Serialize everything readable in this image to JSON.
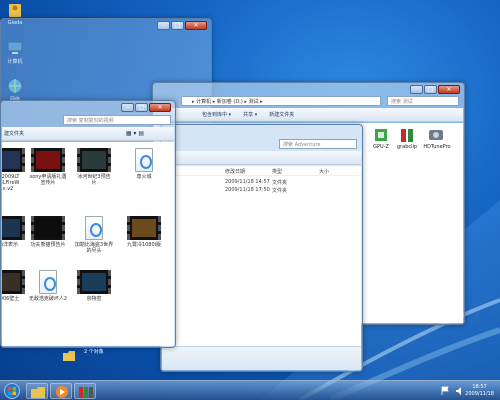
{
  "desktop": {
    "icons": [
      {
        "label": "Giada",
        "icon": "user-folder-icon"
      },
      {
        "label": "计算机",
        "icon": "computer-icon"
      },
      {
        "label": "网络",
        "icon": "network-icon"
      }
    ]
  },
  "back_window": {
    "address": "▸ 计算机 ▸ 新加卷 (D:) ▸ 测试 ▸",
    "search_placeholder": "搜索 测试",
    "toolbar": [
      "包含到库中 ▾",
      "共享 ▾",
      "新建文件夹"
    ],
    "apps": [
      {
        "label": "GPU-Z",
        "icon": "gpuz-icon"
      },
      {
        "label": "grabclip",
        "icon": "grabclip-icon"
      },
      {
        "label": "HDTunePro",
        "icon": "hdtune-icon"
      }
    ]
  },
  "mid_window": {
    "search_placeholder": "搜索 Adventure",
    "columns": [
      "修改日期",
      "类型",
      "大小"
    ],
    "rows": [
      {
        "date": "2009/11/18 14:57",
        "type": "文件夹"
      },
      {
        "date": "2009/11/18 17:50",
        "type": "文件夹"
      }
    ]
  },
  "front_window": {
    "search_placeholder": "搜索 复制复刻的视频",
    "toolbar_label": "建文件夹",
    "thumbnails": [
      {
        "label": "A-2009LT\n03LFireW\nx.v2",
        "kind": "video",
        "color": "#223355"
      },
      {
        "label": "sony申请版礼遇\n宣传片",
        "kind": "video",
        "color": "#7a1010"
      },
      {
        "label": "冰河世纪3预告\n片",
        "kind": "video",
        "color": "#2b3a3a"
      },
      {
        "label": "尊火城",
        "kind": "doc",
        "color": "#ffffff"
      },
      {
        "label": "海洋表示",
        "kind": "video",
        "color": "#1b3550"
      },
      {
        "label": "功夫熊猫预告片",
        "kind": "video",
        "color": "#0d0d0d"
      },
      {
        "label": "加勒比海盗3世界\n的尽头",
        "kind": "doc",
        "color": "#ffffff"
      },
      {
        "label": "九霄冷1080i版",
        "kind": "video",
        "color": "#6b4a1e"
      },
      {
        "label": "3006壁士",
        "kind": "video",
        "color": "#3a2f25"
      },
      {
        "label": "无敌浩克破坏人2",
        "kind": "doc",
        "color": "#ffffff"
      },
      {
        "label": "京特密",
        "kind": "video",
        "color": "#1a3d5a"
      }
    ]
  },
  "bottom_status": "2 个对象",
  "tray": {
    "time": "18:57",
    "date": "2009/11/18"
  },
  "taskbar": {
    "start": "start-orb-icon",
    "items": [
      "explorer-icon",
      "media-player-icon",
      "film-strip-icon"
    ]
  }
}
